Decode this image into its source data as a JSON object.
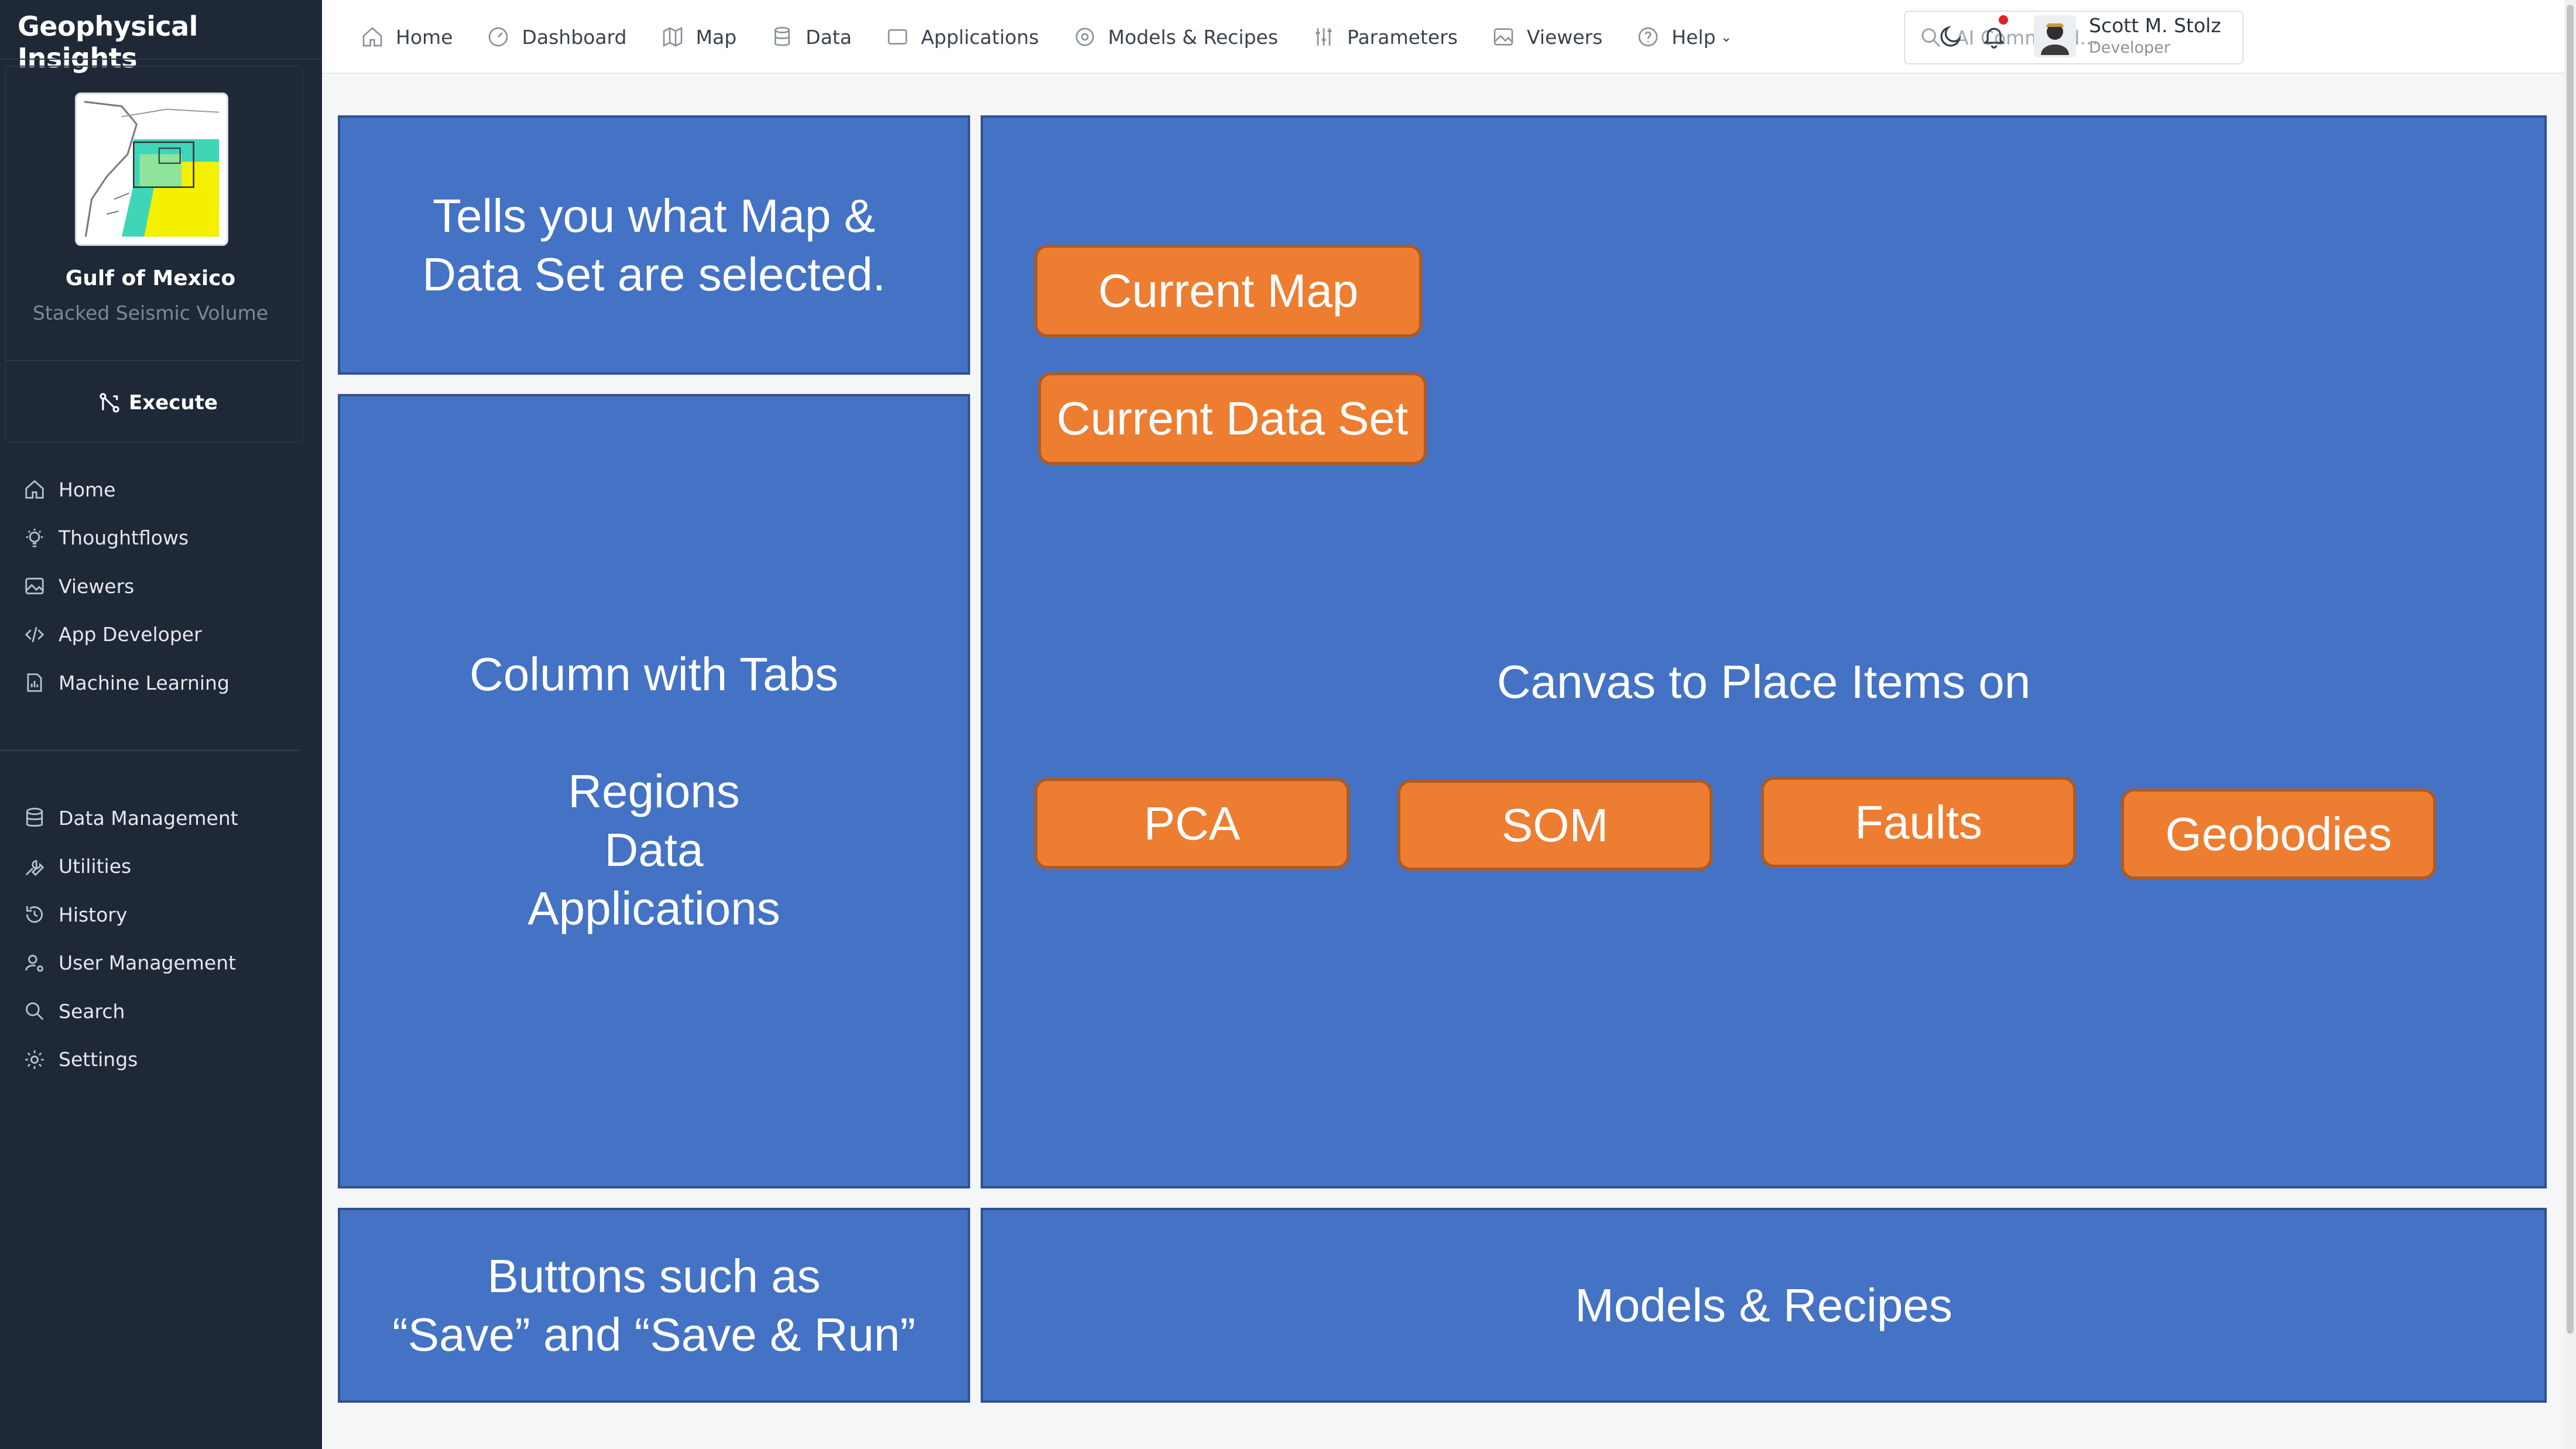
{
  "app": {
    "brand": "Geophysical Insights"
  },
  "project": {
    "name": "Gulf of Mexico",
    "subtitle": "Stacked Seismic Volume",
    "execute_label": "Execute"
  },
  "sidebar": {
    "primary": [
      {
        "label": "Home",
        "icon": "home-icon"
      },
      {
        "label": "Thoughtflows",
        "icon": "lightbulb-icon"
      },
      {
        "label": "Viewers",
        "icon": "image-icon"
      },
      {
        "label": "App Developer",
        "icon": "code-icon"
      },
      {
        "label": "Machine Learning",
        "icon": "document-chart-icon"
      }
    ],
    "secondary": [
      {
        "label": "Data Management",
        "icon": "database-icon"
      },
      {
        "label": "Utilities",
        "icon": "wrench-icon"
      },
      {
        "label": "History",
        "icon": "history-icon"
      },
      {
        "label": "User Management",
        "icon": "user-gear-icon"
      },
      {
        "label": "Search",
        "icon": "search-icon"
      },
      {
        "label": "Settings",
        "icon": "gear-icon"
      }
    ]
  },
  "topnav": {
    "items": [
      {
        "label": "Home",
        "icon": "home-icon"
      },
      {
        "label": "Dashboard",
        "icon": "gauge-icon"
      },
      {
        "label": "Map",
        "icon": "map-icon"
      },
      {
        "label": "Data",
        "icon": "database-icon"
      },
      {
        "label": "Applications",
        "icon": "window-icon"
      },
      {
        "label": "Models & Recipes",
        "icon": "cog-circle-icon"
      },
      {
        "label": "Parameters",
        "icon": "sliders-icon"
      },
      {
        "label": "Viewers",
        "icon": "image-icon"
      },
      {
        "label": "Help",
        "icon": "help-circle-icon"
      }
    ],
    "search_placeholder": "AI Command...",
    "user": {
      "name": "Scott M. Stolz",
      "role": "Developer"
    }
  },
  "mockup": {
    "selection_panel": "Tells you what Map &\nData Set are selected.",
    "tabs_panel": "Column with Tabs\n\nRegions\nData\nApplications",
    "buttons_panel": "Buttons such as\n“Save” and “Save & Run”",
    "canvas_title": "Canvas to Place Items on",
    "models_panel": "Models & Recipes",
    "canvas_items": {
      "current_map": "Current Map",
      "current_data_set": "Current Data Set",
      "pca": "PCA",
      "som": "SOM",
      "faults": "Faults",
      "geobodies": "Geobodies"
    }
  },
  "colors": {
    "sidebar_bg": "#1e2836",
    "panel_fill": "#4472c4",
    "panel_border": "#2f528f",
    "item_fill": "#ed7d31",
    "item_border": "#ae5a21",
    "notification_dot": "#e02424"
  }
}
